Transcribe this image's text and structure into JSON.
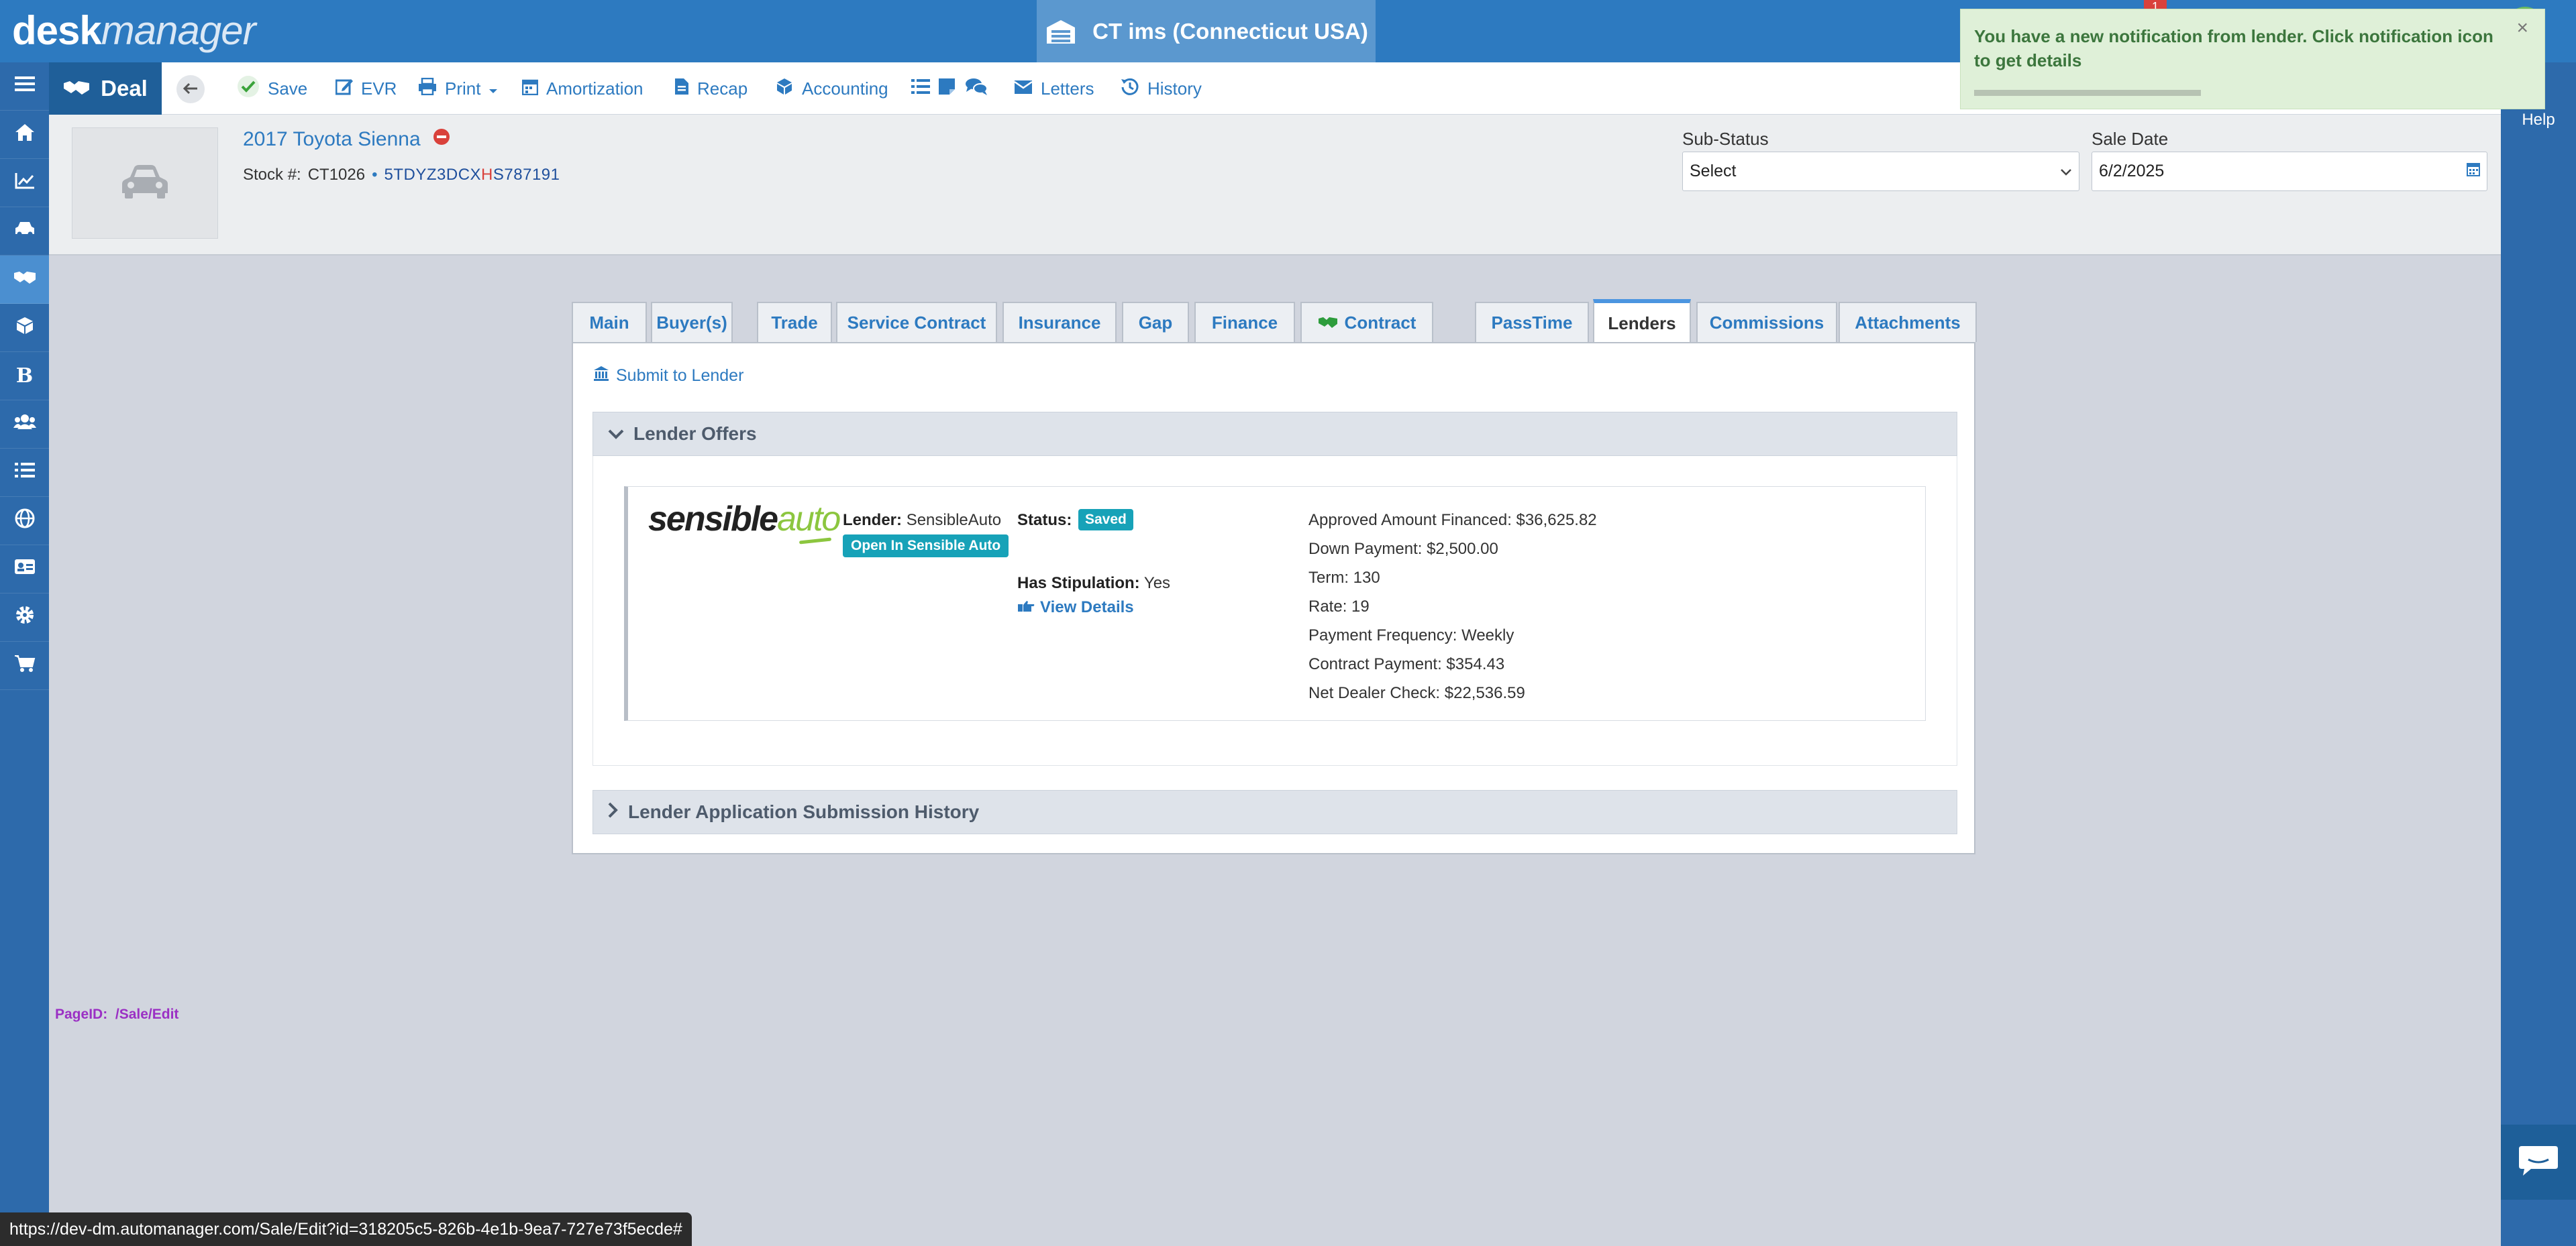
{
  "app": {
    "logo_bold": "desk",
    "logo_italic": "manager",
    "store_name": "CT ims (Connecticut USA)",
    "notification_count": "1",
    "help_label": "Help"
  },
  "sidebar": {
    "items": [
      {
        "icon": "menu-icon"
      },
      {
        "icon": "home-icon"
      },
      {
        "icon": "chart-icon"
      },
      {
        "icon": "car-icon"
      },
      {
        "icon": "handshake-icon"
      },
      {
        "icon": "cubes-icon"
      },
      {
        "icon": "bold-b-icon"
      },
      {
        "icon": "users-icon"
      },
      {
        "icon": "list-icon"
      },
      {
        "icon": "globe-icon"
      },
      {
        "icon": "id-card-icon"
      },
      {
        "icon": "gear-icon"
      },
      {
        "icon": "cart-icon"
      }
    ]
  },
  "toolbar": {
    "deal_label": "Deal",
    "save": "Save",
    "evr": "EVR",
    "print": "Print",
    "amortization": "Amortization",
    "recap": "Recap",
    "accounting": "Accounting",
    "letters": "Letters",
    "history": "History"
  },
  "vehicle": {
    "title": "2017 Toyota Sienna",
    "stock_label": "Stock #:",
    "stock_number": "CT1026",
    "vin_part1": "5TDYZ3DCX",
    "vin_highlight": "H",
    "vin_part2": "S787191"
  },
  "sub_status": {
    "label": "Sub-Status",
    "value": "Select"
  },
  "sale_date": {
    "label": "Sale Date",
    "value": "6/2/2025"
  },
  "notification": {
    "message": "You have a new notification from lender. Click notification icon to get details",
    "close": "×"
  },
  "tabs": [
    {
      "label": "Main"
    },
    {
      "label": "Buyer(s)"
    },
    {
      "label": "Trade"
    },
    {
      "label": "Service Contract"
    },
    {
      "label": "Insurance"
    },
    {
      "label": "Gap"
    },
    {
      "label": "Finance"
    },
    {
      "label": "Contract"
    },
    {
      "label": "PassTime"
    },
    {
      "label": "Lenders"
    },
    {
      "label": "Commissions"
    },
    {
      "label": "Attachments"
    }
  ],
  "lenders": {
    "submit_link": "Submit to Lender",
    "offers_header": "Lender Offers",
    "history_header": "Lender Application Submission History",
    "offer": {
      "logo_sensible": "sensible",
      "logo_auto": "auto",
      "lender_label": "Lender:",
      "lender_value": "SensibleAuto",
      "open_button": "Open In Sensible Auto",
      "status_label": "Status:",
      "status_value": "Saved",
      "stipulation_label": "Has Stipulation:",
      "stipulation_value": "Yes",
      "view_details": "View Details",
      "details": [
        {
          "label": "Approved Amount Financed:",
          "value": "$36,625.82"
        },
        {
          "label": "Down Payment:",
          "value": "$2,500.00"
        },
        {
          "label": "Term:",
          "value": "130"
        },
        {
          "label": "Rate:",
          "value": "19"
        },
        {
          "label": "Payment Frequency:",
          "value": "Weekly"
        },
        {
          "label": "Contract Payment:",
          "value": "$354.43"
        },
        {
          "label": "Net Dealer Check:",
          "value": "$22,536.59"
        }
      ]
    }
  },
  "footer": {
    "page_id_label": "PageID:",
    "page_id_value": "/Sale/Edit",
    "status_url": "https://dev-dm.automanager.com/Sale/Edit?id=318205c5-826b-4e1b-9ea7-727e73f5ecde#"
  },
  "colors": {
    "brand_blue": "#2d7ac0",
    "sidebar_blue": "#2d6aab",
    "saved_badge": "#17a2b8",
    "notification_green": "#dff0d8",
    "sensible_green": "#8cc63f"
  }
}
